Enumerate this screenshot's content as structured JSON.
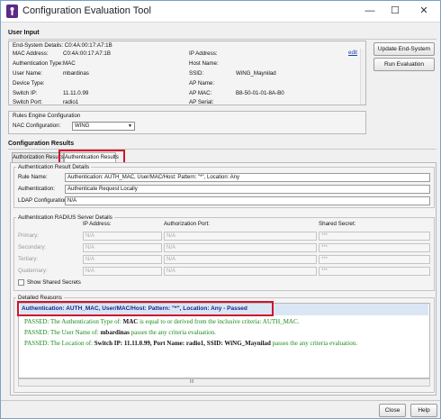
{
  "window": {
    "title": "Configuration Evaluation Tool",
    "min_glyph": "—",
    "max_glyph": "☐",
    "close_glyph": "✕"
  },
  "user_input": {
    "section_title": "User Input",
    "end_system_details": "End-System Details: C0:4A:00:17:A7:1B",
    "edit_link": "edit",
    "fields_left": [
      {
        "label": "MAC Address:",
        "value": "C0:4A:00:17:A7:1B"
      },
      {
        "label": "Authentication Type:",
        "value": "MAC"
      },
      {
        "label": "User Name:",
        "value": "mbardinas"
      },
      {
        "label": "Device Type:",
        "value": ""
      },
      {
        "label": "Switch IP:",
        "value": "11.11.0.99"
      },
      {
        "label": "Switch Port:",
        "value": "radio1"
      }
    ],
    "fields_right": [
      {
        "label": "IP Address:",
        "value": ""
      },
      {
        "label": "Host Name:",
        "value": ""
      },
      {
        "label": "SSID:",
        "value": "WiNG_Maynilad"
      },
      {
        "label": "AP Name:",
        "value": ""
      },
      {
        "label": "AP MAC:",
        "value": "B8-50-01-01-8A-B0"
      },
      {
        "label": "AP Serial:",
        "value": ""
      }
    ],
    "update_button": "Update End-System",
    "run_button": "Run Evaluation",
    "rules_engine_title": "Rules Engine Configuration",
    "nac_config_label": "NAC Configuration:",
    "nac_config_value": "WING"
  },
  "results": {
    "section_title": "Configuration Results",
    "tabs": [
      "Authorization Results",
      "Authentication Results"
    ],
    "auth_details_title": "Authentication Result Details",
    "rule_name_label": "Rule Name:",
    "rule_name_value": "Authentication: AUTH_MAC, User/MAC/Host: Pattern: \"*\", Location: Any",
    "authentication_label": "Authentication:",
    "authentication_value": "Authenticate Request Locally",
    "ldap_label": "LDAP Configuration:",
    "ldap_value": "N/A",
    "radius_title": "Authentication RADIUS Server Details",
    "radius_columns": [
      "IP Address:",
      "Authorization Port:",
      "Shared Secret:"
    ],
    "radius_rows": [
      {
        "name": "Primary:",
        "ip": "N/A",
        "port": "N/A",
        "secret": "***"
      },
      {
        "name": "Secondary:",
        "ip": "N/A",
        "port": "N/A",
        "secret": "***"
      },
      {
        "name": "Tertiary:",
        "ip": "N/A",
        "port": "N/A",
        "secret": "***"
      },
      {
        "name": "Quaternary:",
        "ip": "N/A",
        "port": "N/A",
        "secret": "***"
      }
    ],
    "show_secrets_label": "Show Shared Secrets",
    "detailed_reasons_title": "Detailed Reasons",
    "reason_header": "Authentication: AUTH_MAC, User/MAC/Host: Pattern: \"*\", Location: Any - Passed",
    "reason_lines": [
      {
        "pre": "PASSED: The Authentication Type of: ",
        "bold": "MAC",
        "post": " is equal to or derived from the inclusive criteria: AUTH_MAC."
      },
      {
        "pre": "PASSED: The User Name of: ",
        "bold": "mbardinas",
        "post": " passes the any criteria evaluation."
      },
      {
        "pre": "PASSED: The Location of: ",
        "bold": "Switch IP: 11.11.0.99, Port Name: radio1, SSID: WiNG_Maynilad",
        "post": " passes the any criteria evaluation."
      }
    ],
    "hscroll_grip": "III"
  },
  "footer": {
    "close_button": "Close",
    "help_button": "Help"
  }
}
